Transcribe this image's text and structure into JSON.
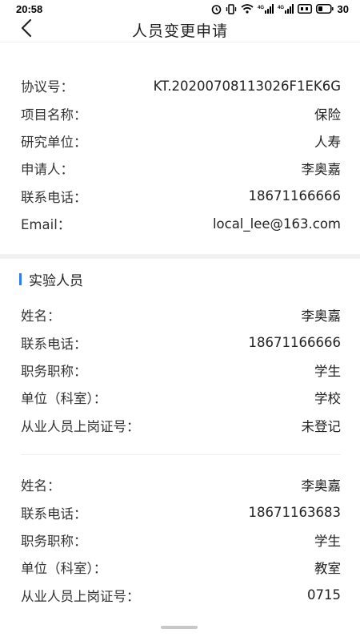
{
  "status_bar": {
    "time": "20:58",
    "battery": "30",
    "network_labels": [
      "4G",
      "4G"
    ]
  },
  "header": {
    "title": "人员变更申请"
  },
  "info": [
    {
      "label": "协议号：",
      "value": "KT.20200708113026F1EK6G"
    },
    {
      "label": "项目名称：",
      "value": "保险"
    },
    {
      "label": "研究单位：",
      "value": "人寿"
    },
    {
      "label": "申请人：",
      "value": "李奥嘉"
    },
    {
      "label": "联系电话：",
      "value": "18671166666"
    },
    {
      "label": "Email：",
      "value": "local_lee@163.com"
    }
  ],
  "section": {
    "title": "实验人员",
    "accent_color": "#2f7cf6"
  },
  "personnel": [
    {
      "rows": [
        {
          "label": "姓名：",
          "value": "李奥嘉"
        },
        {
          "label": "联系电话：",
          "value": "18671166666"
        },
        {
          "label": "职务职称：",
          "value": "学生"
        },
        {
          "label": "单位（科室）：",
          "value": "学校"
        },
        {
          "label": "从业人员上岗证号：",
          "value": "未登记"
        }
      ]
    },
    {
      "rows": [
        {
          "label": "姓名：",
          "value": "李奥嘉"
        },
        {
          "label": "联系电话：",
          "value": "18671163683"
        },
        {
          "label": "职务职称：",
          "value": "学生"
        },
        {
          "label": "单位（科室）：",
          "value": "教室"
        },
        {
          "label": "从业人员上岗证号：",
          "value": "0715"
        }
      ]
    }
  ],
  "icons": {
    "back": "chevron-left-icon",
    "alarm": "alarm-icon",
    "vibrate": "vibrate-icon",
    "wifi": "wifi-icon",
    "signal": "signal-icon",
    "battery": "battery-icon"
  }
}
